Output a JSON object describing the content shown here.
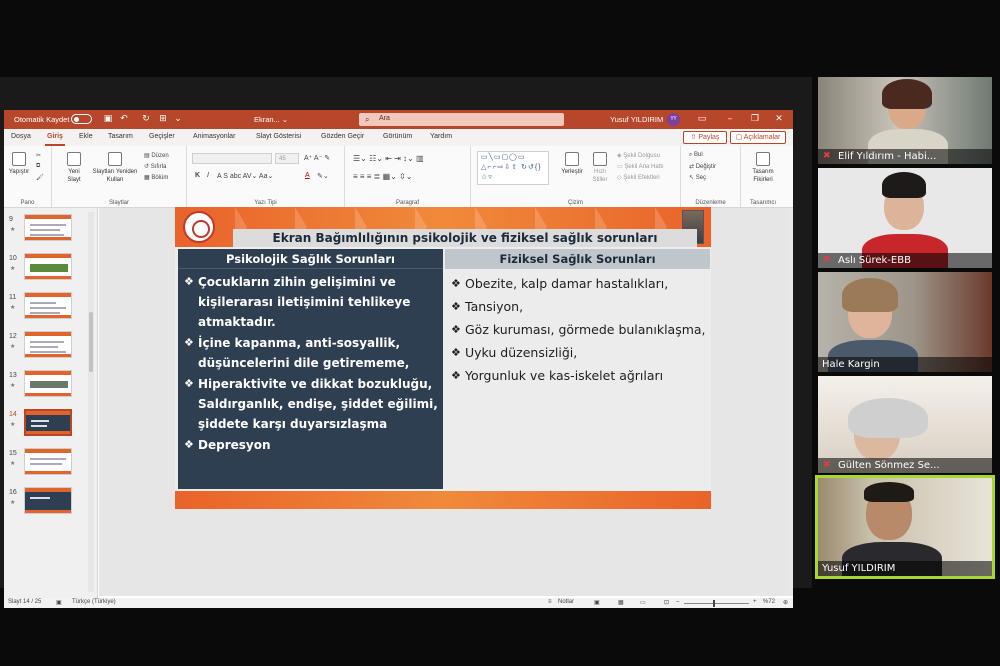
{
  "powerpoint": {
    "autosave_label": "Otomatik Kaydet",
    "doc_name": "Ekran... ⌄",
    "search_placeholder": "Ara",
    "user_name": "Yusuf YILDIRIM",
    "user_initials": "YY",
    "menu": [
      "Dosya",
      "Giriş",
      "Ekle",
      "Tasarım",
      "Geçişler",
      "Animasyonlar",
      "Slayt Gösterisi",
      "Gözden Geçir",
      "Görünüm",
      "Yardım"
    ],
    "active_menu": "Giriş",
    "share_label": "Paylaş",
    "comments_label": "Açıklamalar",
    "ribbon": {
      "pano": {
        "label": "Pano",
        "paste": "Yapıştır"
      },
      "slaytlar": {
        "label": "Slaytlar",
        "new_slide": "Yeni Slayt",
        "reuse": "Slaytları Yeniden Kullan",
        "layout": "Düzen",
        "reset": "Sıfırla",
        "section": "Bölüm"
      },
      "yazi_tipi": {
        "label": "Yazı Tipi",
        "size": "45",
        "bold": "K",
        "italic": "I",
        "underline": "A"
      },
      "paragraf": {
        "label": "Paragraf"
      },
      "cizim": {
        "label": "Çizim",
        "arrange": "Yerleştir",
        "quick_styles": "Hızlı Stiller",
        "fill": "Şekil Dolgusu",
        "outline": "Şekil Ana Hattı",
        "effects": "Şekil Efektleri"
      },
      "duzenleme": {
        "label": "Düzenleme",
        "find": "Bul",
        "replace": "Değiştir",
        "select": "Seç"
      },
      "tasarimci": {
        "label": "Tasarımcı",
        "ideas": "Tasarım Fikirleri"
      }
    },
    "thumbnails": [
      {
        "num": "9",
        "star": "★"
      },
      {
        "num": "10",
        "star": "★"
      },
      {
        "num": "11",
        "star": "★"
      },
      {
        "num": "12",
        "star": "★"
      },
      {
        "num": "13",
        "star": "★"
      },
      {
        "num": "14",
        "star": "★"
      },
      {
        "num": "15",
        "star": "★"
      },
      {
        "num": "16",
        "star": "★"
      }
    ],
    "selected_thumbnail": "14",
    "status": {
      "slide_info": "Slayt 14 / 25",
      "language": "Türkçe (Türkiye)",
      "notes": "Notlar",
      "zoom": "%72"
    }
  },
  "slide": {
    "title": "Ekran Bağımlılığının psikolojik ve fiziksel sağlık sorunları",
    "left_header": "Psikolojik Sağlık Sorunları",
    "right_header": "Fiziksel Sağlık Sorunları",
    "left_items": [
      "Çocukların zihin gelişimini ve kişilerarası iletişimini tehlikeye atmaktadır.",
      "İçine kapanma, anti-sosyallik, düşüncelerini dile getirememe,",
      "Hiperaktivite ve dikkat bozukluğu, Saldırganlık, endişe, şiddet eğilimi, şiddete karşı duyarsızlaşma",
      "Depresyon"
    ],
    "right_items": [
      "Obezite, kalp damar hastalıkları,",
      "Tansiyon,",
      "Göz kuruması, görmede bulanıklaşma,",
      "Uyku düzensizliği,",
      "Yorgunluk ve kas-iskelet ağrıları"
    ],
    "colors": {
      "orange": "#e9632a",
      "navy": "#2e3f52",
      "light": "#ececec"
    }
  },
  "participants": [
    {
      "name": "Elif Yıldırım - Habi...",
      "muted": true
    },
    {
      "name": "Aslı Sürek-EBB",
      "muted": true
    },
    {
      "name": "Hale Kargin",
      "muted": false
    },
    {
      "name": "Gülten Sönmez Se...",
      "muted": true
    },
    {
      "name": "Yusuf YILDIRIM",
      "muted": false,
      "active_speaker": true
    }
  ],
  "icons": {
    "muted": "mic-muted-icon",
    "search": "search-icon"
  },
  "accent_colors": {
    "powerpoint": "#b7472a",
    "active_speaker": "#a8d830"
  }
}
